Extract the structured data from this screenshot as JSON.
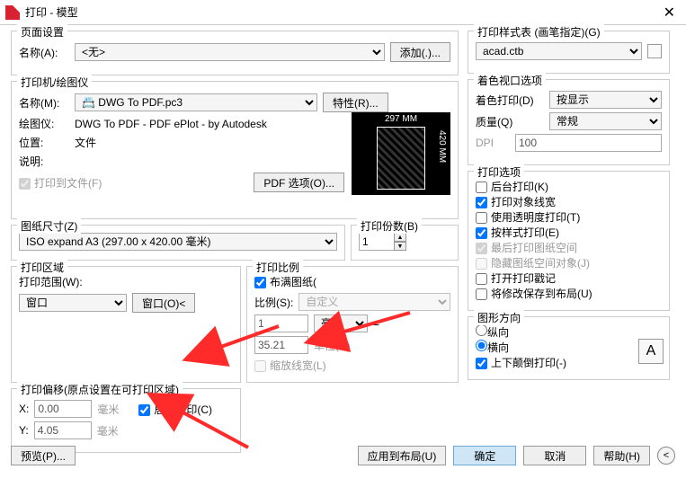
{
  "window": {
    "title": "打印 - 模型"
  },
  "page_setup": {
    "legend": "页面设置",
    "name_label": "名称(A):",
    "name_value": "<无>",
    "add_btn": "添加(.)..."
  },
  "printer": {
    "legend": "打印机/绘图仪",
    "name_label": "名称(M):",
    "name_value": "📇 DWG To PDF.pc3",
    "props_btn": "特性(R)...",
    "plotter_label": "绘图仪:",
    "plotter_value": "DWG To PDF - PDF ePlot - by Autodesk",
    "where_label": "位置:",
    "where_value": "文件",
    "desc_label": "说明:",
    "to_file": "打印到文件(F)",
    "pdf_opts": "PDF 选项(O)...",
    "paper_w": "297 MM",
    "paper_h": "420 MM"
  },
  "paper_size": {
    "legend": "图纸尺寸(Z)",
    "value": "ISO expand A3 (297.00 x 420.00 毫米)"
  },
  "copies": {
    "legend": "打印份数(B)",
    "value": "1"
  },
  "area": {
    "legend": "打印区域",
    "what_label": "打印范围(W):",
    "what_value": "窗口",
    "window_btn": "窗口(O)<"
  },
  "scale": {
    "legend": "打印比例",
    "fit": "布满图纸(",
    "ratio_label": "比例(S):",
    "ratio_value": "自定义",
    "num": "1",
    "unit": "毫米",
    "den": "35.21",
    "unit_label": "单位(N)",
    "lw": "缩放线宽(L)"
  },
  "offset": {
    "legend": "打印偏移(原点设置在可打印区域)",
    "x_label": "X:",
    "x_value": "0.00",
    "y_label": "Y:",
    "y_value": "4.05",
    "unit": "毫米",
    "center": "居中打印(C)"
  },
  "style_table": {
    "legend": "打印样式表 (画笔指定)(G)",
    "value": "acad.ctb"
  },
  "shaded": {
    "legend": "着色视口选项",
    "shade_label": "着色打印(D)",
    "shade_value": "按显示",
    "quality_label": "质量(Q)",
    "quality_value": "常规",
    "dpi_label": "DPI",
    "dpi_value": "100"
  },
  "options": {
    "legend": "打印选项",
    "bg": "后台打印(K)",
    "lw": "打印对象线宽",
    "trans": "使用透明度打印(T)",
    "styles": "按样式打印(E)",
    "last": "最后打印图纸空间",
    "hide": "隐藏图纸空间对象(J)",
    "stamp": "打开打印戳记",
    "save": "将修改保存到布局(U)"
  },
  "orient": {
    "legend": "图形方向",
    "portrait": "纵向",
    "landscape": "横向",
    "upside": "上下颠倒打印(-)"
  },
  "footer": {
    "preview": "预览(P)...",
    "apply": "应用到布局(U)",
    "ok": "确定",
    "cancel": "取消",
    "help": "帮助(H)"
  }
}
